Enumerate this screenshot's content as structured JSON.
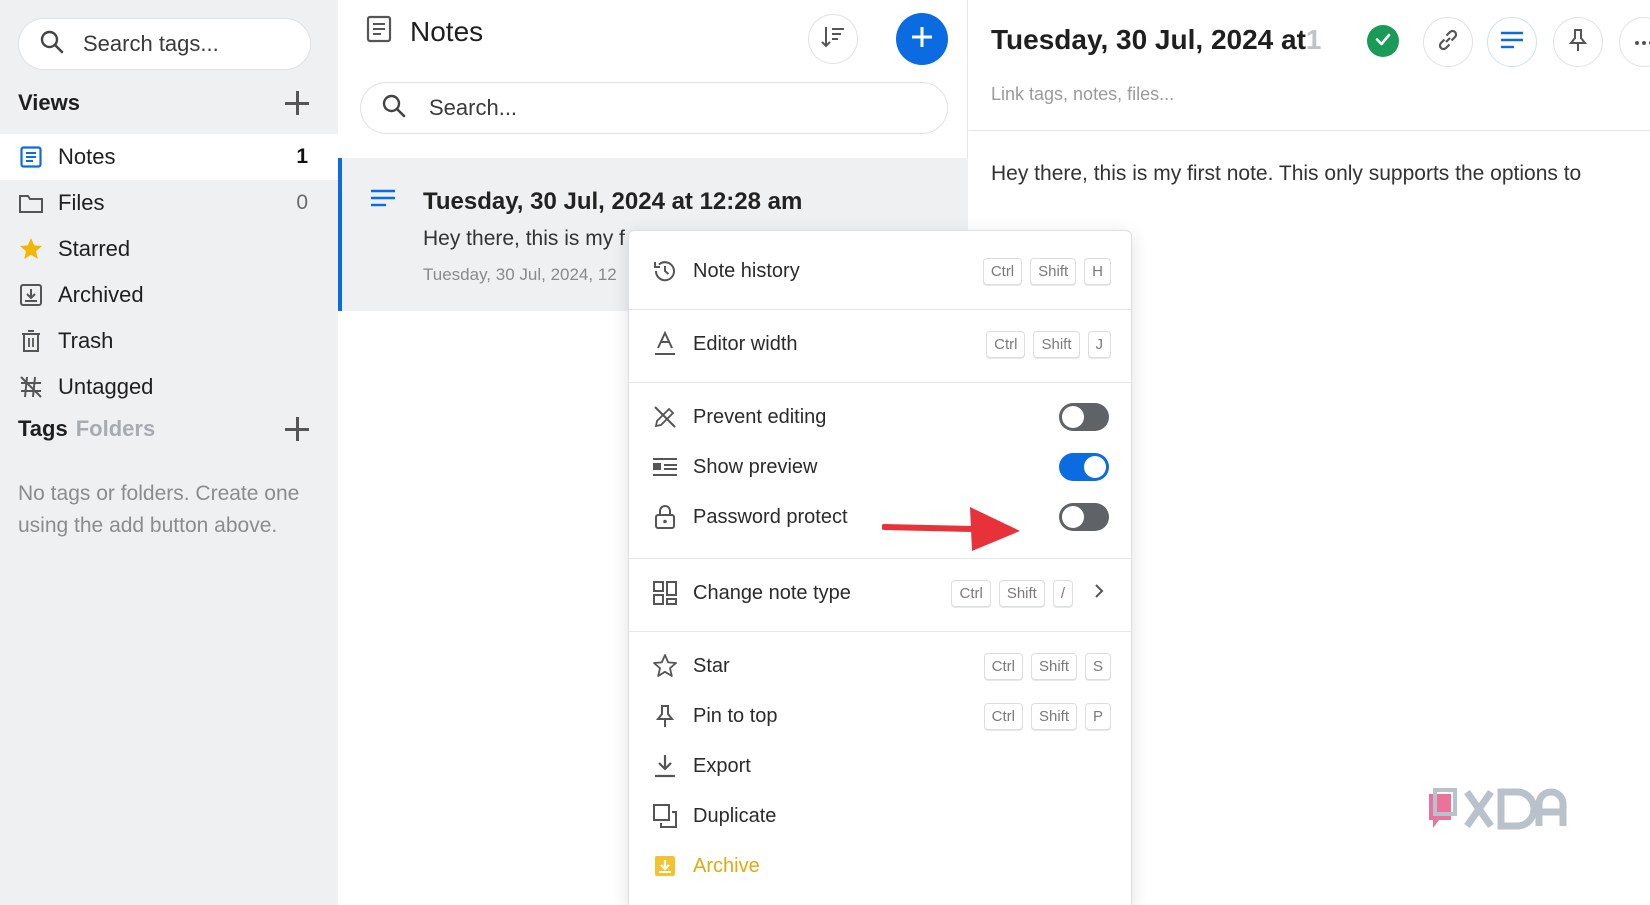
{
  "sidebar": {
    "search_placeholder": "Search tags...",
    "views_title": "Views",
    "items": [
      {
        "label": "Notes",
        "count": "1",
        "icon": "notes-icon"
      },
      {
        "label": "Files",
        "count": "0",
        "icon": "folder-icon"
      },
      {
        "label": "Starred",
        "count": "",
        "icon": "star-icon"
      },
      {
        "label": "Archived",
        "count": "",
        "icon": "archive-icon"
      },
      {
        "label": "Trash",
        "count": "",
        "icon": "trash-icon"
      },
      {
        "label": "Untagged",
        "count": "",
        "icon": "untagged-icon"
      }
    ],
    "tags_title": "Tags",
    "folders_label": "Folders",
    "empty_text": "No tags or folders. Create one using the add button above."
  },
  "notes_list": {
    "title": "Notes",
    "search_placeholder": "Search...",
    "note": {
      "title": "Tuesday, 30 Jul, 2024 at 12:28 am",
      "preview": "Hey there, this is my f",
      "date": "Tuesday, 30 Jul, 2024, 12"
    }
  },
  "editor": {
    "title": "Tuesday, 30 Jul, 2024 at",
    "title_fade": "1",
    "link_placeholder": "Link tags, notes, files...",
    "body": "Hey there, this is my first note. This only supports the options to"
  },
  "menu": {
    "note_history": {
      "label": "Note history",
      "keys": [
        "Ctrl",
        "Shift",
        "H"
      ]
    },
    "editor_width": {
      "label": "Editor width",
      "keys": [
        "Ctrl",
        "Shift",
        "J"
      ]
    },
    "prevent_editing": {
      "label": "Prevent editing",
      "on": false
    },
    "show_preview": {
      "label": "Show preview",
      "on": true
    },
    "password_protect": {
      "label": "Password protect",
      "on": false
    },
    "change_note_type": {
      "label": "Change note type",
      "keys": [
        "Ctrl",
        "Shift",
        "/"
      ]
    },
    "star": {
      "label": "Star",
      "keys": [
        "Ctrl",
        "Shift",
        "S"
      ]
    },
    "pin_to_top": {
      "label": "Pin to top",
      "keys": [
        "Ctrl",
        "Shift",
        "P"
      ]
    },
    "export": {
      "label": "Export"
    },
    "duplicate": {
      "label": "Duplicate"
    },
    "archive": {
      "label": "Archive"
    }
  },
  "colors": {
    "accent": "#0b6be0",
    "sidebar_bg": "#eef0f2",
    "saved_badge": "#1a9a57",
    "archive": "#e1a912",
    "star": "#f2b705",
    "arrow": "#e8323a"
  }
}
